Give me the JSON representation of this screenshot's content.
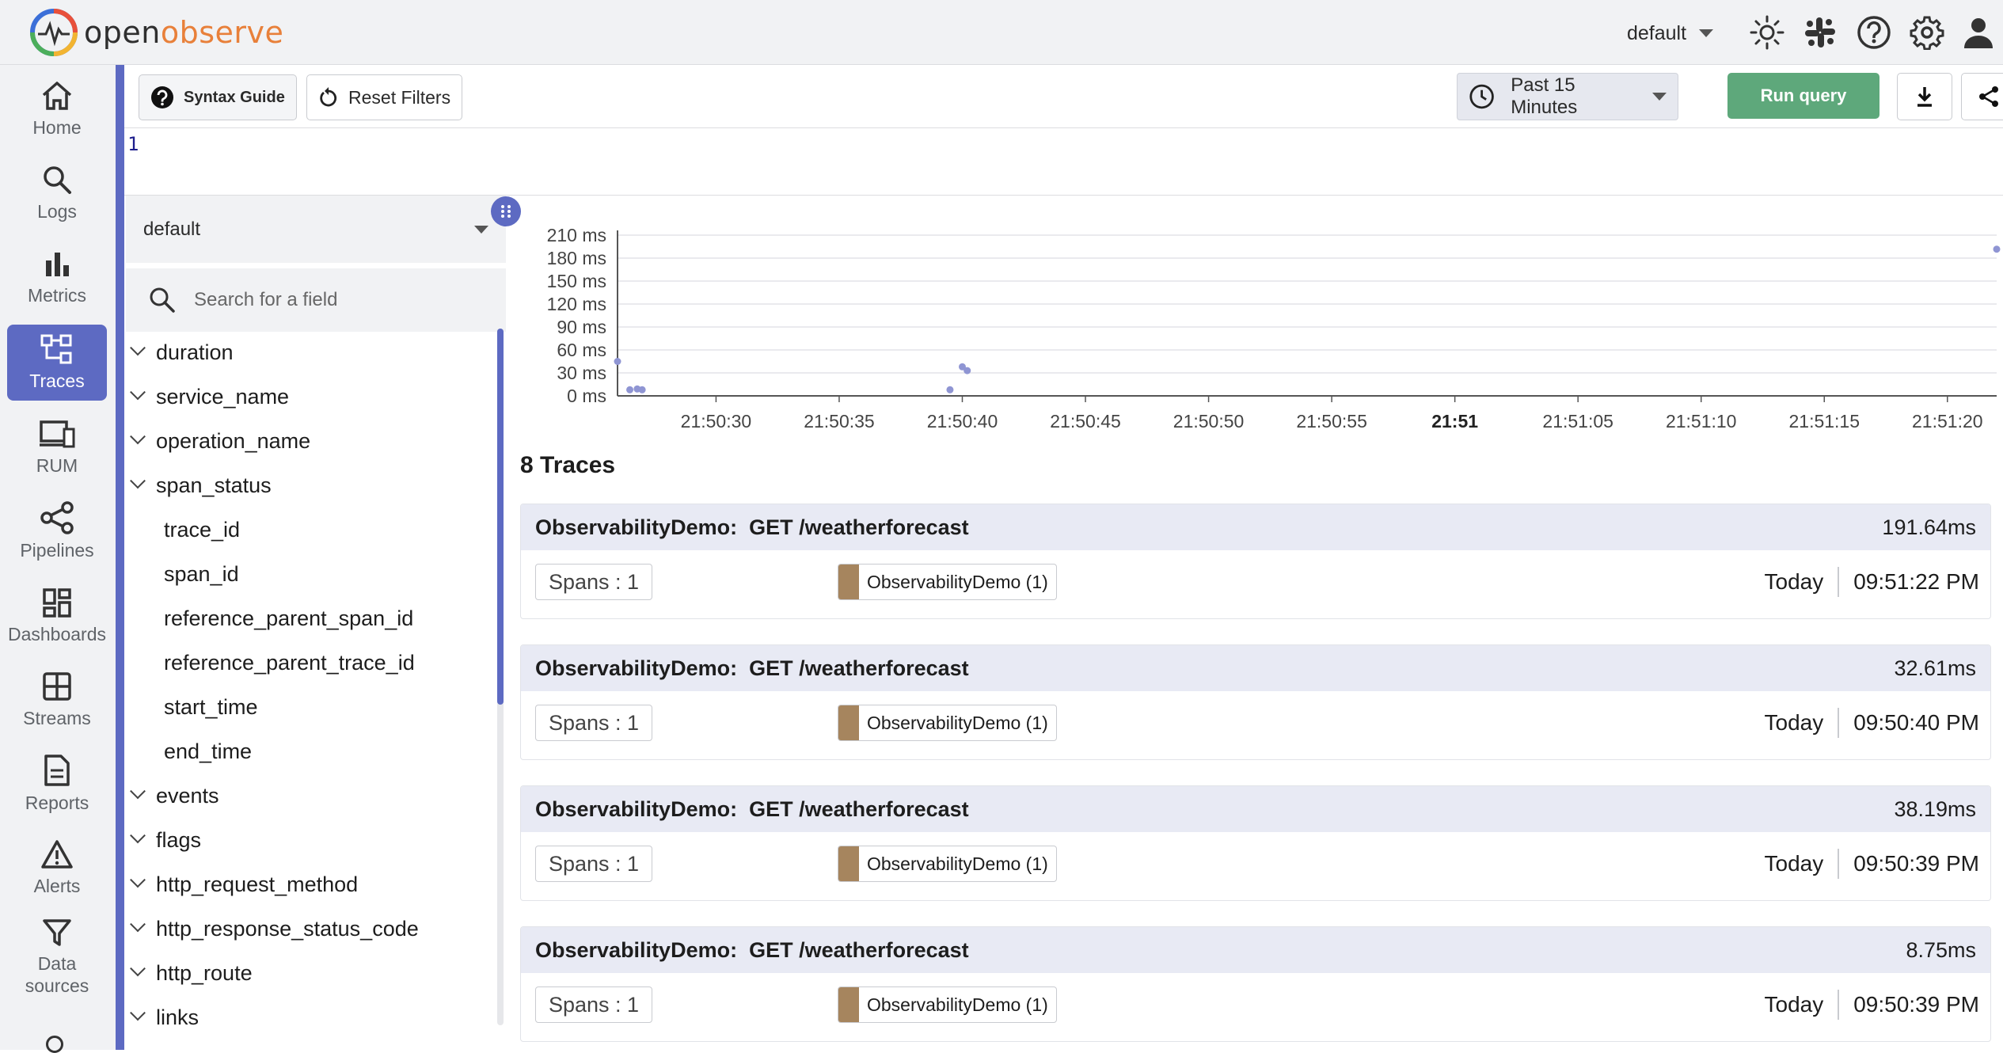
{
  "header": {
    "logo_text_a": "open",
    "logo_text_b": "observe",
    "org": "default"
  },
  "nav": [
    {
      "key": "home",
      "label": "Home"
    },
    {
      "key": "logs",
      "label": "Logs"
    },
    {
      "key": "metrics",
      "label": "Metrics"
    },
    {
      "key": "traces",
      "label": "Traces"
    },
    {
      "key": "rum",
      "label": "RUM"
    },
    {
      "key": "pipelines",
      "label": "Pipelines"
    },
    {
      "key": "dashboards",
      "label": "Dashboards"
    },
    {
      "key": "streams",
      "label": "Streams"
    },
    {
      "key": "reports",
      "label": "Reports"
    },
    {
      "key": "alerts",
      "label": "Alerts"
    },
    {
      "key": "data-sources",
      "label": "Data\nsources"
    }
  ],
  "toolbar": {
    "syntax_guide": "Syntax Guide",
    "reset_filters": "Reset Filters",
    "time_range": "Past 15 Minutes",
    "run_query": "Run query"
  },
  "editor": {
    "line_number": "1"
  },
  "fields": {
    "stream": "default",
    "search_placeholder": "Search for a field",
    "items": [
      {
        "name": "duration",
        "expandable": true
      },
      {
        "name": "service_name",
        "expandable": true
      },
      {
        "name": "operation_name",
        "expandable": true
      },
      {
        "name": "span_status",
        "expandable": true
      },
      {
        "name": "trace_id",
        "expandable": false
      },
      {
        "name": "span_id",
        "expandable": false
      },
      {
        "name": "reference_parent_span_id",
        "expandable": false
      },
      {
        "name": "reference_parent_trace_id",
        "expandable": false
      },
      {
        "name": "start_time",
        "expandable": false
      },
      {
        "name": "end_time",
        "expandable": false
      },
      {
        "name": "events",
        "expandable": true
      },
      {
        "name": "flags",
        "expandable": true
      },
      {
        "name": "http_request_method",
        "expandable": true
      },
      {
        "name": "http_response_status_code",
        "expandable": true
      },
      {
        "name": "http_route",
        "expandable": true
      },
      {
        "name": "links",
        "expandable": true
      }
    ]
  },
  "chart_data": {
    "type": "scatter",
    "y_ticks": [
      "0 ms",
      "30 ms",
      "60 ms",
      "90 ms",
      "120 ms",
      "150 ms",
      "180 ms",
      "210 ms"
    ],
    "ylim": [
      0,
      210
    ],
    "x_ticks": [
      "21:50:30",
      "21:50:35",
      "21:50:40",
      "21:50:45",
      "21:50:50",
      "21:50:55",
      "21:51",
      "21:51:05",
      "21:51:10",
      "21:51:15",
      "21:51:20"
    ],
    "x_tick_bold": "21:51",
    "xlim": [
      "21:50:26",
      "21:51:22"
    ],
    "grid": true,
    "point_color": "#8f95d3",
    "points": [
      {
        "x": "21:50:26",
        "y": 45
      },
      {
        "x": "21:50:26.5",
        "y": 8
      },
      {
        "x": "21:50:26.8",
        "y": 9
      },
      {
        "x": "21:50:27",
        "y": 8
      },
      {
        "x": "21:50:39.5",
        "y": 8
      },
      {
        "x": "21:50:40",
        "y": 38
      },
      {
        "x": "21:50:40.2",
        "y": 33
      },
      {
        "x": "21:51:22",
        "y": 191.64
      }
    ]
  },
  "traces": {
    "count_label": "8 Traces",
    "items": [
      {
        "title": "ObservabilityDemo:  GET /weatherforecast",
        "duration": "191.64ms",
        "spans": "Spans : 1",
        "service": "ObservabilityDemo (1)",
        "day": "Today",
        "time": "09:51:22 PM"
      },
      {
        "title": "ObservabilityDemo:  GET /weatherforecast",
        "duration": "32.61ms",
        "spans": "Spans : 1",
        "service": "ObservabilityDemo (1)",
        "day": "Today",
        "time": "09:50:40 PM"
      },
      {
        "title": "ObservabilityDemo:  GET /weatherforecast",
        "duration": "38.19ms",
        "spans": "Spans : 1",
        "service": "ObservabilityDemo (1)",
        "day": "Today",
        "time": "09:50:39 PM"
      },
      {
        "title": "ObservabilityDemo:  GET /weatherforecast",
        "duration": "8.75ms",
        "spans": "Spans : 1",
        "service": "ObservabilityDemo (1)",
        "day": "Today",
        "time": "09:50:39 PM"
      }
    ]
  },
  "colors": {
    "accent": "#5d6ac2",
    "run": "#5ea87b",
    "service": "#a6855e"
  }
}
